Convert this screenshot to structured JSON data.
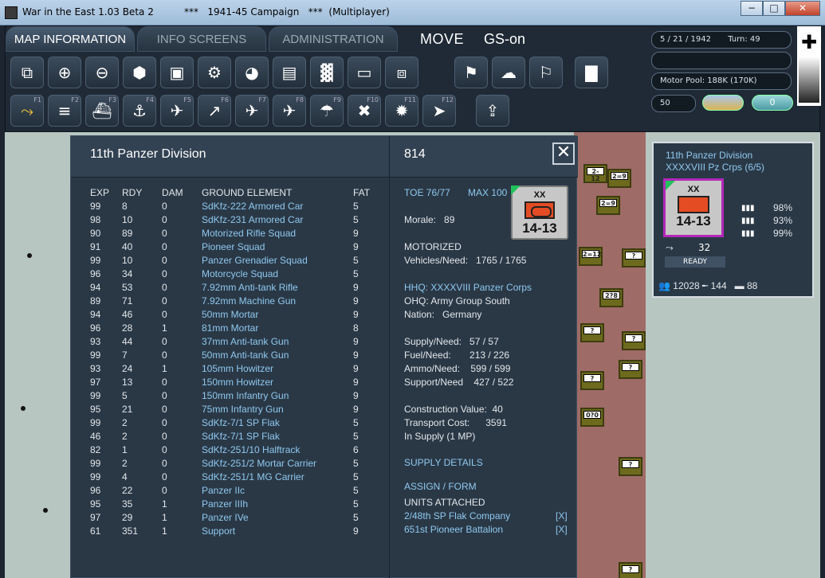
{
  "window": {
    "title": "War in the East 1.03 Beta 2          ***   1941-45 Campaign   ***  (Multiplayer)",
    "min": "−",
    "max": "□",
    "close": "✕"
  },
  "tabs": [
    {
      "label": "MAP INFORMATION",
      "active": true
    },
    {
      "label": "INFO SCREENS",
      "active": false
    },
    {
      "label": "ADMINISTRATION",
      "active": false
    }
  ],
  "mode": {
    "move": "MOVE",
    "gs": "GS-on"
  },
  "toolbar1": [
    {
      "name": "overlay-toggle-icon",
      "glyph": "⧉"
    },
    {
      "name": "zoom-in-icon",
      "glyph": "⊕"
    },
    {
      "name": "zoom-out-icon",
      "glyph": "⊖"
    },
    {
      "name": "hex-grid-icon",
      "glyph": "⬢"
    },
    {
      "name": "unit-frame-icon",
      "glyph": "▣"
    },
    {
      "name": "settings-gear-icon",
      "glyph": "⚙"
    },
    {
      "name": "unit-dot-icon",
      "glyph": "◕"
    },
    {
      "name": "unit-stack-icon",
      "glyph": "▤"
    },
    {
      "name": "factory-icon",
      "glyph": "▓"
    },
    {
      "name": "rectangle-icon",
      "glyph": "▭"
    },
    {
      "name": "target-frame-icon",
      "glyph": "⧈"
    },
    {
      "name": "flag-arrow-icon",
      "glyph": "⚑"
    },
    {
      "name": "weather-icon",
      "glyph": "☁"
    },
    {
      "name": "flag-outline-icon",
      "glyph": "⚐"
    },
    {
      "name": "bar-blocks-icon",
      "glyph": "▇"
    }
  ],
  "toolbar2": [
    {
      "name": "path-icon",
      "glyph": "⤳",
      "key": "F1",
      "hl": true
    },
    {
      "name": "rail-icon",
      "glyph": "≡",
      "key": "F2"
    },
    {
      "name": "naval-transport-icon",
      "glyph": "⛴",
      "key": "F3"
    },
    {
      "name": "naval-icon",
      "glyph": "⚓",
      "key": "F4"
    },
    {
      "name": "air-recon-icon",
      "glyph": "✈",
      "key": "F5"
    },
    {
      "name": "air-transfer-icon",
      "glyph": "↗",
      "key": "F6"
    },
    {
      "name": "air-bomb-icon",
      "glyph": "✈",
      "key": "F7"
    },
    {
      "name": "airfield-icon",
      "glyph": "✈",
      "key": "F8"
    },
    {
      "name": "airdrop-icon",
      "glyph": "☂",
      "key": "F9"
    },
    {
      "name": "air-strike-icon",
      "glyph": "✖",
      "key": "F10"
    },
    {
      "name": "explosion-icon",
      "glyph": "✹",
      "key": "F11"
    },
    {
      "name": "end-turn-icon",
      "glyph": "➤",
      "key": "F12"
    },
    {
      "name": "upload-icon",
      "glyph": "⇪",
      "key": ""
    }
  ],
  "status": {
    "date": "5 / 21 / 1942",
    "turn": "Turn: 49",
    "blank": "",
    "motor_pool": "Motor Pool:  188K (170K)",
    "value": "50",
    "toggle": "0"
  },
  "panel": {
    "unit_name": "11th Panzer Division",
    "unit_number": "814",
    "close": "✕",
    "headers": [
      "EXP",
      "RDY",
      "DAM",
      "GROUND ELEMENT",
      "FAT"
    ],
    "elements": [
      [
        "99",
        "8",
        "0",
        "SdKfz-222 Armored Car",
        "5"
      ],
      [
        "98",
        "10",
        "0",
        "SdKfz-231 Armored Car",
        "5"
      ],
      [
        "90",
        "89",
        "0",
        "Motorized Rifle Squad",
        "9"
      ],
      [
        "91",
        "40",
        "0",
        "Pioneer Squad",
        "9"
      ],
      [
        "99",
        "10",
        "0",
        "Panzer Grenadier Squad",
        "5"
      ],
      [
        "96",
        "34",
        "0",
        "Motorcycle Squad",
        "5"
      ],
      [
        "94",
        "53",
        "0",
        "7.92mm Anti-tank Rifle",
        "9"
      ],
      [
        "89",
        "71",
        "0",
        "7.92mm Machine Gun",
        "9"
      ],
      [
        "94",
        "46",
        "0",
        "50mm Mortar",
        "9"
      ],
      [
        "96",
        "28",
        "1",
        "81mm Mortar",
        "8"
      ],
      [
        "93",
        "44",
        "0",
        "37mm Anti-tank Gun",
        "9"
      ],
      [
        "99",
        "7",
        "0",
        "50mm Anti-tank Gun",
        "9"
      ],
      [
        "93",
        "24",
        "1",
        "105mm Howitzer",
        "9"
      ],
      [
        "97",
        "13",
        "0",
        "150mm Howitzer",
        "9"
      ],
      [
        "99",
        "5",
        "0",
        "150mm Infantry Gun",
        "9"
      ],
      [
        "95",
        "21",
        "0",
        "75mm Infantry Gun",
        "9"
      ],
      [
        "99",
        "2",
        "0",
        "SdKfz-7/1 SP Flak",
        "5"
      ],
      [
        "46",
        "2",
        "0",
        "SdKfz-7/1 SP Flak",
        "5"
      ],
      [
        "82",
        "1",
        "0",
        "SdKfz-251/10 Halftrack",
        "6"
      ],
      [
        "99",
        "2",
        "0",
        "SdKfz-251/2 Mortar Carrier",
        "5"
      ],
      [
        "99",
        "4",
        "0",
        "SdKfz-251/1 MG Carrier",
        "5"
      ],
      [
        "96",
        "22",
        "0",
        "Panzer IIc",
        "5"
      ],
      [
        "95",
        "35",
        "1",
        "Panzer IIIh",
        "5"
      ],
      [
        "97",
        "29",
        "1",
        "Panzer IVe",
        "5"
      ],
      [
        "61",
        "351",
        "1",
        "Support",
        "9"
      ]
    ],
    "toe": "TOE 76/77",
    "max": "MAX 100",
    "morale": "Morale:   89",
    "counter": {
      "size": "XX",
      "strength": "14-13"
    },
    "motorized": "MOTORIZED",
    "vehicles": "Vehicles/Need:   1765 / 1765",
    "hhq": "HHQ: XXXXVIII Panzer Corps",
    "ohq": "OHQ: Army Group South",
    "nation": "Nation:   Germany",
    "supply": "Supply/Need:   57 / 57",
    "fuel": "Fuel/Need:       213 / 226",
    "ammo": "Ammo/Need:    599 / 599",
    "support": "Support/Need    427 / 522",
    "construction": "Construction Value:  40",
    "transport": "Transport Cost:      3591",
    "insupply": "In Supply (1 MP)",
    "supply_details": "SUPPLY DETAILS",
    "assign": "ASSIGN / FORM",
    "attached_header": "UNITS ATTACHED",
    "attached": [
      {
        "name": "2/48th SP Flak Company",
        "x": "[X]"
      },
      {
        "name": "651st Pioneer Battalion",
        "x": "[X]"
      }
    ]
  },
  "unitbox": {
    "name": "11th Panzer Division",
    "corps": "XXXXVIII Pz Crps (6/5)",
    "counter": {
      "size": "XX",
      "strength": "14-13"
    },
    "pcts": [
      "98%",
      "93%",
      "99%"
    ],
    "mp": "32",
    "mp_icon": "⤳",
    "ready": "READY",
    "men": "12028",
    "guns": "144",
    "tanks": "88"
  },
  "map_counters": [
    {
      "label": "2-12"
    },
    {
      "label": "2=9"
    },
    {
      "label": "2=9"
    },
    {
      "label": "2=12"
    },
    {
      "label": "?"
    },
    {
      "label": "2?8"
    },
    {
      "label": "?"
    },
    {
      "label": "?"
    },
    {
      "label": "?"
    },
    {
      "label": "?"
    },
    {
      "label": "0?0"
    },
    {
      "label": "?"
    },
    {
      "label": "?"
    }
  ]
}
